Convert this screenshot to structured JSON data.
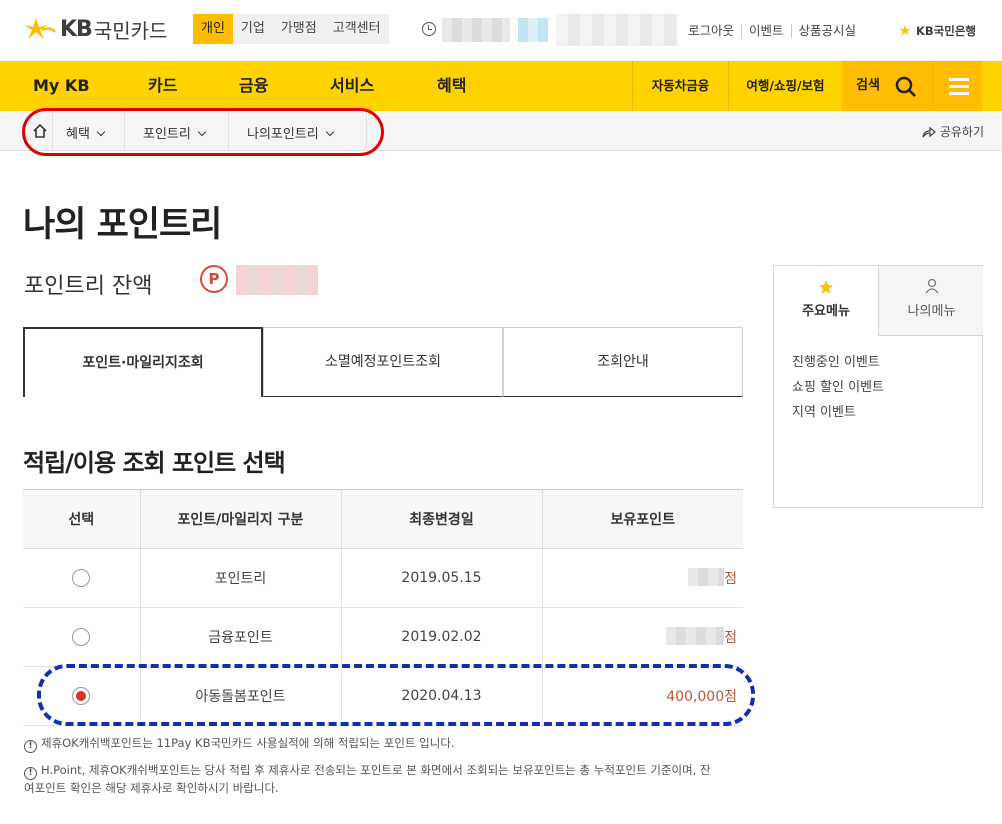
{
  "header": {
    "brand_kb": "KB",
    "brand_name": "국민카드",
    "segments": [
      "개인",
      "기업",
      "가맹점",
      "고객센터"
    ],
    "active_segment": "개인",
    "top_links": [
      "로그아웃",
      "이벤트",
      "상품공시실"
    ],
    "bank_link": "KB국민은행"
  },
  "gnb": {
    "items": [
      "My KB",
      "카드",
      "금융",
      "서비스",
      "혜택"
    ],
    "right_items": [
      "자동차금융",
      "여행/쇼핑/보험"
    ],
    "search_label": "검색"
  },
  "breadcrumb": {
    "items": [
      "혜택",
      "포인트리",
      "나의포인트리"
    ],
    "share_label": "공유하기"
  },
  "page": {
    "title": "나의 포인트리",
    "balance_label": "포인트리 잔액",
    "badge": "P"
  },
  "tabs": [
    "포인트·마일리지조회",
    "소멸예정포인트조회",
    "조회안내"
  ],
  "section_title": "적립/이용 조회 포인트 선택",
  "table": {
    "headers": [
      "선택",
      "포인트/마일리지 구분",
      "최종변경일",
      "보유포인트"
    ],
    "rows": [
      {
        "name": "포인트리",
        "date": "2019.05.15",
        "amount": "점",
        "selected": false
      },
      {
        "name": "금융포인트",
        "date": "2019.02.02",
        "amount": "점",
        "selected": false
      },
      {
        "name": "아동돌봄포인트",
        "date": "2020.04.13",
        "amount": "400,000점",
        "selected": true
      }
    ]
  },
  "notes": [
    "제휴OK캐쉬백포인트는 11Pay KB국민카드 사용실적에 의해 적립되는 포인트 입니다.",
    "H.Point, 제휴OK캐쉬백포인트는 당사 적립 후 제휴사로 전송되는 포인트로 본 화면에서 조회되는 보유포인트는 총 누적포인트 기준이며, 잔",
    "여포인트 확인은 해당 제휴사로 확인하시기 바랍니다."
  ],
  "side": {
    "tabs": [
      "주요메뉴",
      "나의메뉴"
    ],
    "links": [
      "진행중인 이벤트",
      "쇼핑 할인 이벤트",
      "지역 이벤트"
    ]
  },
  "colors": {
    "brand_yellow": "#ffd200",
    "accent_yellow": "#ffbc00",
    "point_red": "#d34b3a",
    "annotation_red": "#e00000",
    "annotation_blue": "#1030b0"
  },
  "icons": [
    "kb-star-logo-icon",
    "clock-icon",
    "home-icon",
    "chevron-down-icon",
    "share-icon",
    "search-icon",
    "hamburger-icon",
    "star-icon",
    "person-icon",
    "exclamation-icon"
  ]
}
